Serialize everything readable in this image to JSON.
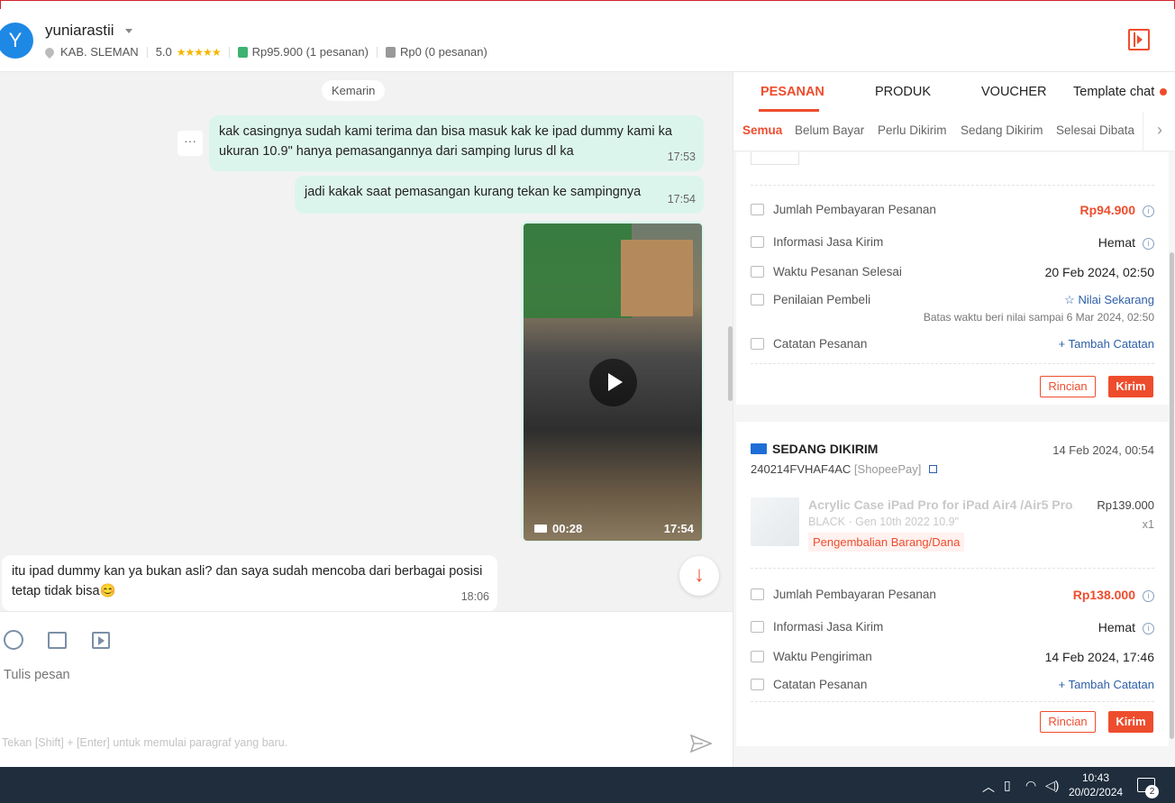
{
  "header": {
    "avatar_letter": "Y",
    "username": "yuniarastii",
    "location": "KAB. SLEMAN",
    "rating": "5.0",
    "stars": "★★★★★",
    "paid_orders": "Rp95.900 (1 pesanan)",
    "cancelled_orders": "Rp0 (0 pesanan)"
  },
  "chat": {
    "day_label": "Kemarin",
    "messages": [
      {
        "text": "kak casingnya sudah kami terima dan bisa masuk kak ke ipad dummy kami ka ukuran 10.9\" hanya pemasangannya dari samping lurus dl ka",
        "time": "17:53"
      },
      {
        "text": "jadi kakak saat pemasangan kurang tekan ke sampingnya",
        "time": "17:54"
      },
      {
        "video_duration": "00:28",
        "time": "17:54"
      },
      {
        "text": "itu ipad dummy kan ya bukan asli? dan saya sudah mencoba dari berbagai posisi tetap tidak bisa😊",
        "time": "18:06"
      }
    ],
    "more_label": "···",
    "scroll_down": "↓"
  },
  "composer": {
    "placeholder": "Tulis pesan",
    "hint": "Tekan [Shift] + [Enter] untuk memulai paragraf yang baru."
  },
  "panel": {
    "tabs": [
      {
        "label": "PESANAN",
        "active": true
      },
      {
        "label": "PRODUK"
      },
      {
        "label": "VOUCHER"
      },
      {
        "label": "Template chat"
      }
    ],
    "subtabs": [
      "Semua",
      "Belum Bayar",
      "Perlu Dikirim",
      "Sedang Dikirim",
      "Selesai",
      "Dibata"
    ],
    "order1": {
      "payment_label": "Jumlah Pembayaran Pesanan",
      "payment_value": "Rp94.900",
      "shipping_label": "Informasi Jasa Kirim",
      "shipping_value": "Hemat",
      "completed_label": "Waktu Pesanan Selesai",
      "completed_value": "20 Feb 2024, 02:50",
      "rating_label": "Penilaian Pembeli",
      "rating_value": "Nilai Sekarang",
      "rating_deadline": "Batas waktu beri nilai sampai 6 Mar 2024, 02:50",
      "note_label": "Catatan Pesanan",
      "note_value": "Tambah Catatan",
      "btn_detail": "Rincian",
      "btn_send": "Kirim"
    },
    "order2": {
      "status": "SEDANG DIKIRIM",
      "date": "14 Feb 2024, 00:54",
      "order_id": "240214FVHAF4AC",
      "pay_method": "[ShopeePay]",
      "product_name": "Acrylic Case iPad Pro for iPad Air4 /Air5 Pro...",
      "variant": "BLACK · Gen 10th 2022 10.9\"",
      "price": "Rp139.000",
      "qty": "x1",
      "return_badge": "Pengembalian Barang/Dana",
      "payment_label": "Jumlah Pembayaran Pesanan",
      "payment_value": "Rp138.000",
      "shipping_label": "Informasi Jasa Kirim",
      "shipping_value": "Hemat",
      "ship_time_label": "Waktu Pengiriman",
      "ship_time_value": "14 Feb 2024, 17:46",
      "note_label": "Catatan Pesanan",
      "note_value": "Tambah Catatan",
      "btn_detail": "Rincian",
      "btn_send": "Kirim"
    }
  },
  "taskbar": {
    "time": "10:43",
    "date": "20/02/2024",
    "notif_count": "2"
  },
  "colors": {
    "accent": "#ee4d2d",
    "outgoing_bubble": "#dcf5ec",
    "link": "#2d5fa8",
    "taskbar": "#1f2d3d"
  }
}
